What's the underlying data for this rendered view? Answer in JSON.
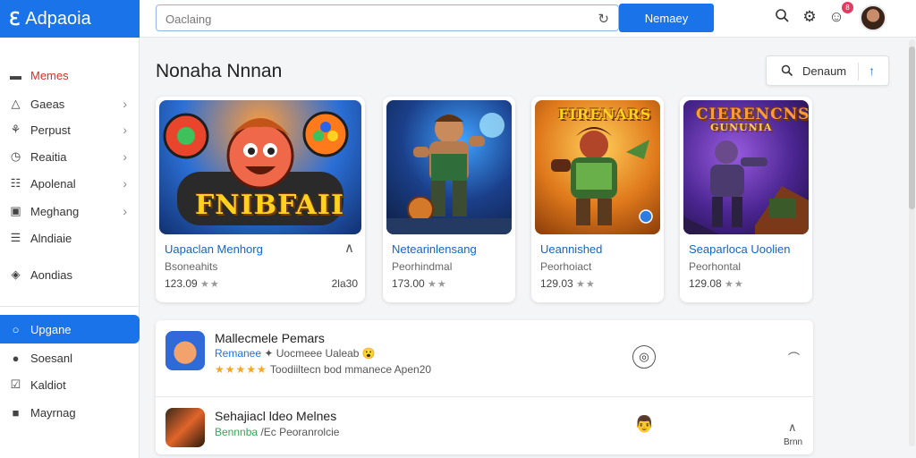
{
  "app": {
    "logo_icon": "ℇ",
    "name": "Adpaoia",
    "brand_color": "#1a73e8"
  },
  "search": {
    "placeholder": "Oaclaing",
    "button_label": "Nemaey",
    "refresh_icon": "refresh-icon"
  },
  "header_icons": [
    "search-icon",
    "gear-icon",
    "notification-icon",
    "avatar"
  ],
  "notification_count": "8",
  "sidebar": {
    "items": [
      {
        "label": "Memes",
        "icon": "▬",
        "chevron": false,
        "style": "red"
      },
      {
        "label": "Gaeas",
        "icon": "△",
        "chevron": true
      },
      {
        "label": "Perpust",
        "icon": "⚘",
        "chevron": true
      },
      {
        "label": "Reaitia",
        "icon": "◷",
        "chevron": true
      },
      {
        "label": "Apolenal",
        "icon": "☷",
        "chevron": true
      },
      {
        "label": "Meghang",
        "icon": "▣",
        "chevron": true
      },
      {
        "label": "Alndiaie",
        "icon": "☰",
        "chevron": false
      },
      {
        "label": "Aondias",
        "icon": "◈",
        "chevron": false
      },
      {
        "label": "Upgane",
        "icon": "○",
        "chevron": false,
        "style": "active"
      },
      {
        "label": "Soesanl",
        "icon": "●",
        "chevron": false
      },
      {
        "label": "Kaldiot",
        "icon": "☑",
        "chevron": false
      },
      {
        "label": "Mayrnag",
        "icon": "■",
        "chevron": false
      }
    ]
  },
  "main": {
    "title": "Nonaha Nnnan",
    "sort_label": "Denaum",
    "sort_arrow": "↑",
    "cards": [
      {
        "art_title": "FNIBFAII",
        "title": "Uapaclan Menhorg",
        "subtitle": "Bsoneahits",
        "rating": "123.09",
        "stars": "★★",
        "extra": "2la30",
        "chevron": "∧"
      },
      {
        "art_title": "",
        "title": "Netearinlensang",
        "subtitle": "Peorhindmal",
        "rating": "173.00",
        "stars": "★★"
      },
      {
        "art_title": "FIRENARS",
        "title": "Ueannished",
        "subtitle": "Peorhoiact",
        "rating": "129.03",
        "stars": "★★"
      },
      {
        "art_title": "CIERENCNS",
        "art_subtitle": "GUNUNIA",
        "title": "Seaparloca Uoolien",
        "subtitle": "Peorhontal",
        "rating": "129.08",
        "stars": "★★"
      }
    ],
    "list": [
      {
        "title": "Mallecmele Pemars",
        "line1_blue": "Remanee",
        "line1_rest": "✦ Uocmeee Ualeab 😮",
        "stars": "★★★★★",
        "line2_rest": "Toodiiltecn  bod mmanece  Apen20",
        "action_icon": "◎",
        "chevron": "⌒"
      },
      {
        "title": "Sehajiacl ldeo Melnes",
        "line1_green": "Bennnba",
        "line1_rest": "/Ec  Peoranrolcie",
        "action_icon": "👨",
        "chevron": "∧",
        "small_text": "Brnn"
      }
    ]
  }
}
